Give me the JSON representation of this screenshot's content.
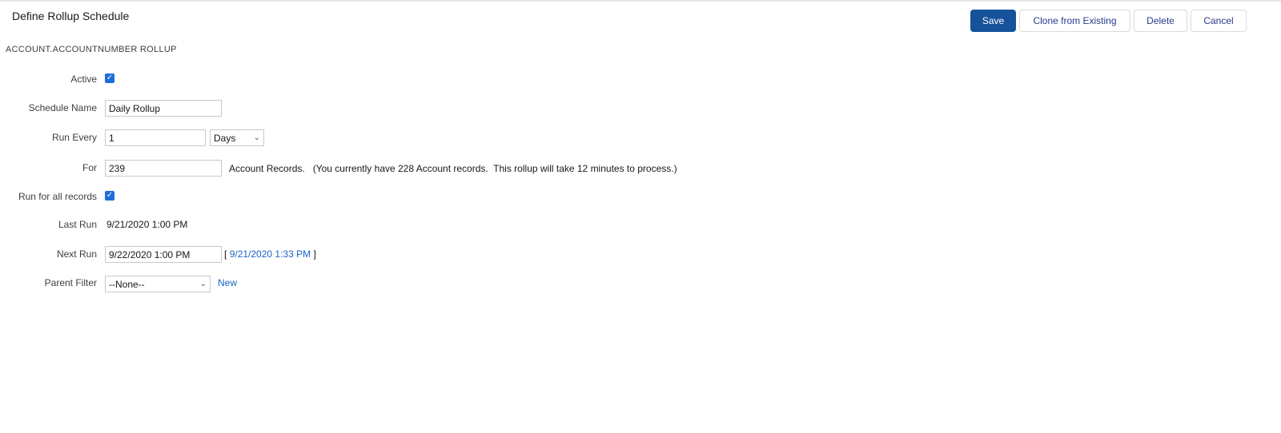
{
  "header": {
    "title": "Define Rollup Schedule",
    "subtitle": "ACCOUNT.ACCOUNTNUMBER ROLLUP"
  },
  "toolbar": {
    "save": "Save",
    "clone": "Clone from Existing",
    "delete": "Delete",
    "cancel": "Cancel"
  },
  "form": {
    "active": {
      "label": "Active",
      "checked": true
    },
    "schedule_name": {
      "label": "Schedule Name",
      "value": "Daily Rollup"
    },
    "run_every": {
      "label": "Run Every",
      "value": "1",
      "unit": "Days"
    },
    "for": {
      "label": "For",
      "value": "239",
      "note": "Account Records.   (You currently have 228 Account records.  This rollup will take 12 minutes to process.)"
    },
    "run_all": {
      "label": "Run for all records",
      "checked": true
    },
    "last_run": {
      "label": "Last Run",
      "value": "9/21/2020 1:00 PM"
    },
    "next_run": {
      "label": "Next Run",
      "value": "9/22/2020 1:00 PM",
      "bracket_open": "[",
      "link": "9/21/2020 1:33 PM",
      "bracket_close": "]"
    },
    "parent_filter": {
      "label": "Parent Filter",
      "value": "--None--",
      "new_link": "New"
    }
  },
  "colors": {
    "primary": "#16529a",
    "link": "#1b63c6",
    "checkbox": "#1b6fd6"
  }
}
